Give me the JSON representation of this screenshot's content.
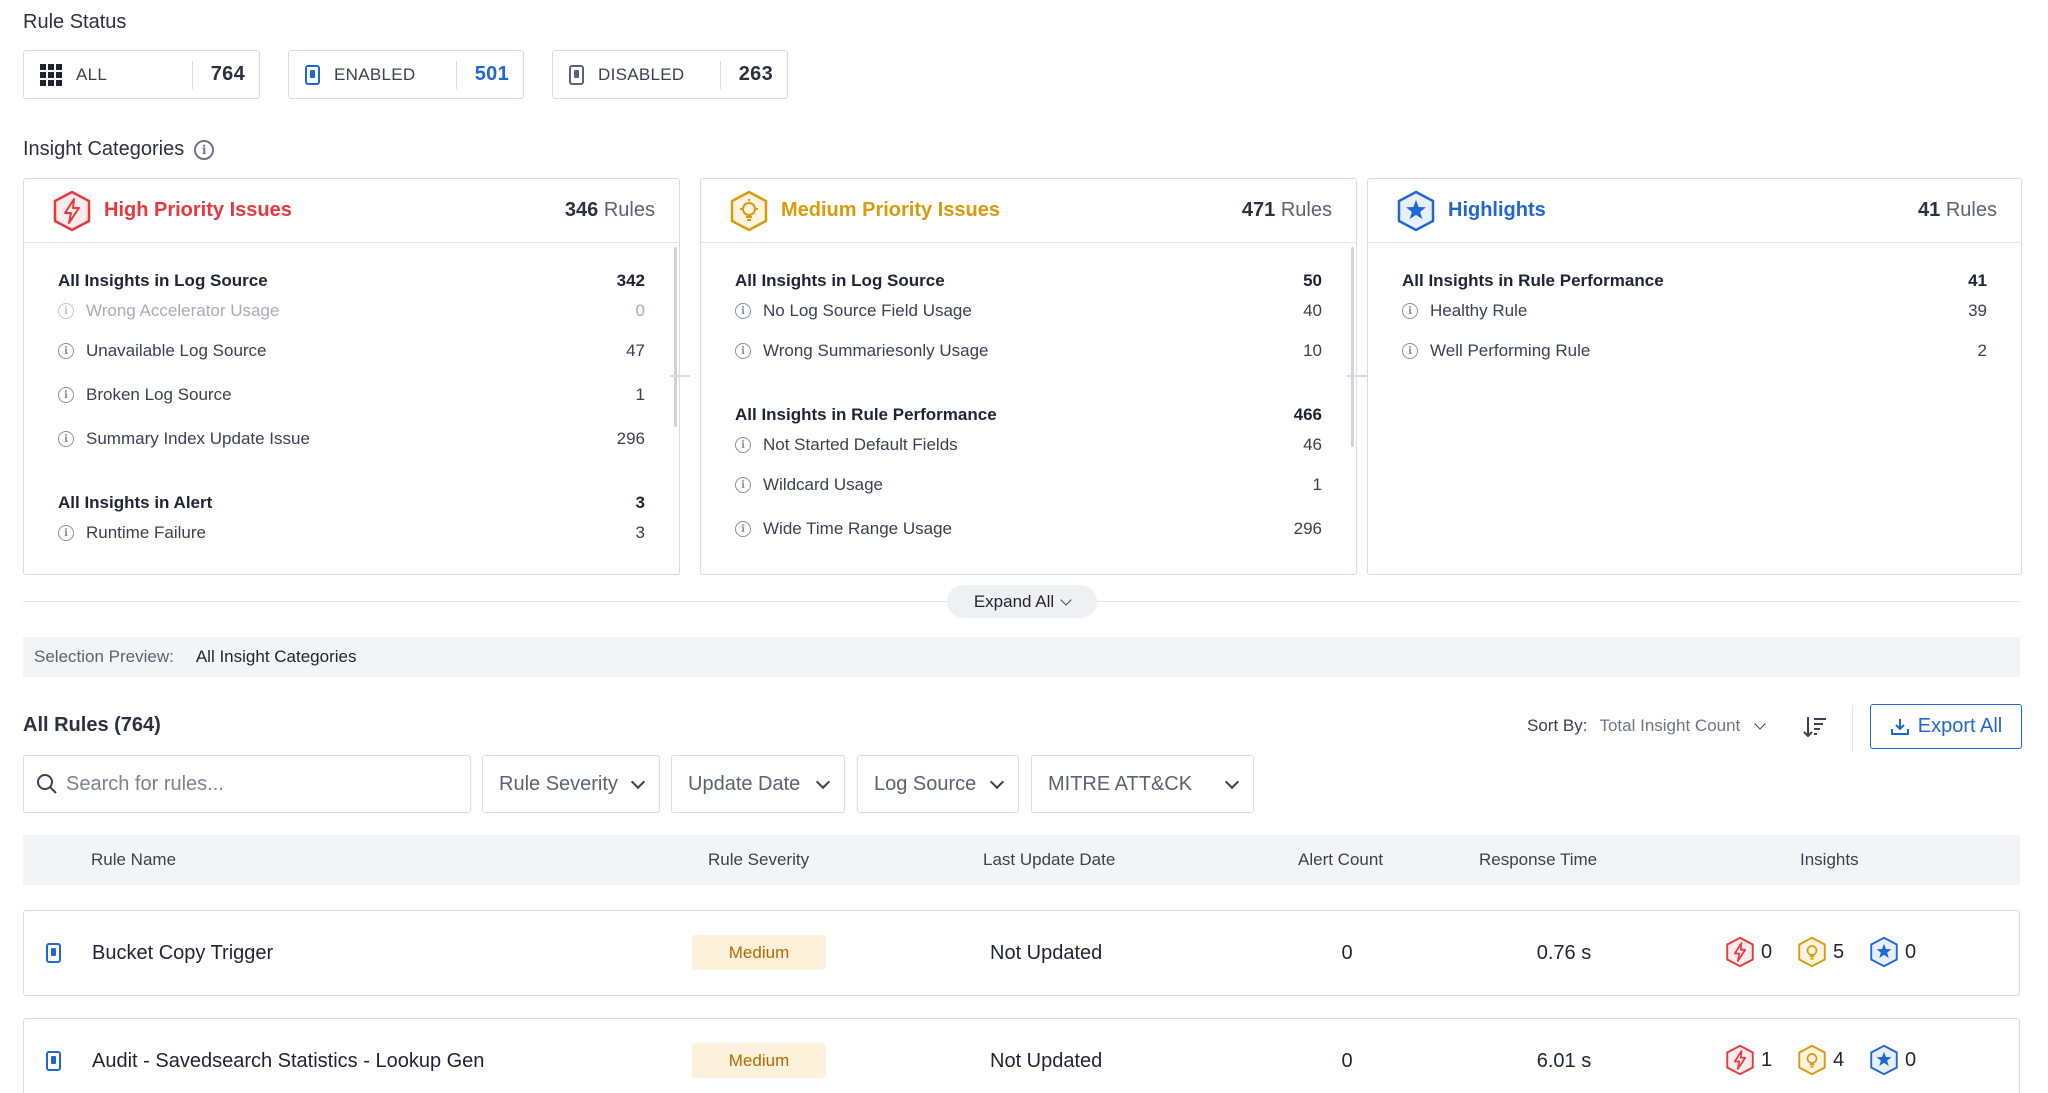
{
  "rule_status": {
    "title": "Rule Status",
    "cards": [
      {
        "label": "ALL",
        "count": "764",
        "icon": "grid-icon"
      },
      {
        "label": "ENABLED",
        "count": "501",
        "icon": "enabled-rule-icon"
      },
      {
        "label": "DISABLED",
        "count": "263",
        "icon": "disabled-rule-icon"
      }
    ]
  },
  "insight_categories": {
    "title": "Insight Categories",
    "cards": [
      {
        "title": "High Priority Issues",
        "count": "346",
        "rules_word": "Rules",
        "color": "#e8383d",
        "groups": [
          {
            "label": "All Insights in Log Source",
            "count": "342",
            "items": [
              {
                "label": "Wrong Accelerator Usage",
                "count": "0"
              },
              {
                "label": "Unavailable Log Source",
                "count": "47"
              },
              {
                "label": "Broken Log Source",
                "count": "1"
              },
              {
                "label": "Summary Index Update Issue",
                "count": "296"
              }
            ]
          },
          {
            "label": "All Insights in Alert",
            "count": "3",
            "items": [
              {
                "label": "Runtime Failure",
                "count": "3"
              }
            ]
          }
        ]
      },
      {
        "title": "Medium Priority Issues",
        "count": "471",
        "rules_word": "Rules",
        "color": "#d99a0b",
        "groups": [
          {
            "label": "All Insights in Log Source",
            "count": "50",
            "items": [
              {
                "label": "No Log Source Field Usage",
                "count": "40"
              },
              {
                "label": "Wrong Summariesonly Usage",
                "count": "10"
              }
            ]
          },
          {
            "label": "All Insights in Rule Performance",
            "count": "466",
            "items": [
              {
                "label": "Not Started Default Fields",
                "count": "46"
              },
              {
                "label": "Wildcard Usage",
                "count": "1"
              },
              {
                "label": "Wide Time Range Usage",
                "count": "296"
              }
            ]
          }
        ]
      },
      {
        "title": "Highlights",
        "count": "41",
        "rules_word": "Rules",
        "color": "#2067d6",
        "groups": [
          {
            "label": "All Insights in Rule Performance",
            "count": "41",
            "items": [
              {
                "label": "Healthy Rule",
                "count": "39"
              },
              {
                "label": "Well Performing Rule",
                "count": "2"
              }
            ]
          }
        ]
      }
    ],
    "expand_label": "Expand All"
  },
  "selection_preview": {
    "label": "Selection Preview:",
    "value": "All Insight Categories"
  },
  "rules": {
    "title": "All Rules (764)",
    "sort_label": "Sort By:",
    "sort_value": "Total Insight Count",
    "export_label": "Export All",
    "search_placeholder": "Search for rules...",
    "filters": [
      "Rule Severity",
      "Update Date",
      "Log Source",
      "MITRE ATT&CK"
    ],
    "columns": [
      "Rule Name",
      "Rule Severity",
      "Last Update Date",
      "Alert Count",
      "Response Time",
      "Insights"
    ],
    "rows": [
      {
        "name": "Bucket Copy Trigger",
        "severity": "Medium",
        "date": "Not Updated",
        "alerts": "0",
        "response": "0.76 s",
        "high": "0",
        "medium": "5",
        "highlight": "0"
      },
      {
        "name": "Audit - Savedsearch Statistics - Lookup Gen",
        "severity": "Medium",
        "date": "Not Updated",
        "alerts": "0",
        "response": "6.01 s",
        "high": "1",
        "medium": "4",
        "highlight": "0"
      }
    ]
  }
}
